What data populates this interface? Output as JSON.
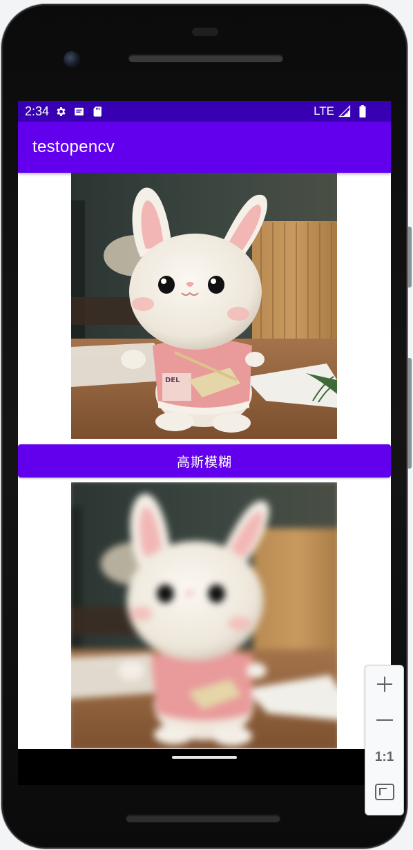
{
  "status_bar": {
    "time": "2:34",
    "network": "LTE",
    "icons": [
      "gear-icon",
      "notification-icon",
      "sd-card-icon",
      "signal-icon",
      "battery-icon"
    ]
  },
  "app_bar": {
    "title": "testopencv"
  },
  "images": {
    "original": "plush-bunny-photo",
    "result": "plush-bunny-photo-blurred"
  },
  "action_button": {
    "label": "高斯模糊"
  },
  "emulator_zoom": {
    "zoom_in": "zoom-in-icon",
    "zoom_out": "zoom-out-icon",
    "actual_size_label": "1:1",
    "fit_screen": "fit-screen-icon"
  },
  "colors": {
    "status_bar": "#3700b3",
    "primary": "#6200ee",
    "on_primary": "#ffffff"
  }
}
